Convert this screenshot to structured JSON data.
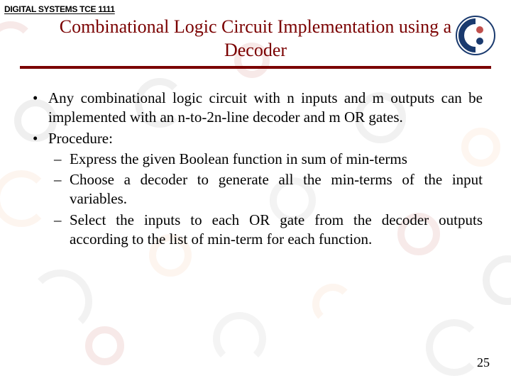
{
  "course_label": "DIGITAL SYSTEMS TCE 1111",
  "title": "Combinational Logic Circuit Implementation using a Decoder",
  "bullets": [
    "Any combinational logic circuit with n inputs and m outputs can be implemented with an n-to-2n-line decoder and m OR gates.",
    "Procedure:"
  ],
  "subbullets": [
    "Express the given Boolean function in sum of min-terms",
    "Choose a decoder to generate all the min-terms of the input variables.",
    "Select the inputs to each OR gate from the decoder outputs according to the list of min-term for each function."
  ],
  "page_number": "25"
}
